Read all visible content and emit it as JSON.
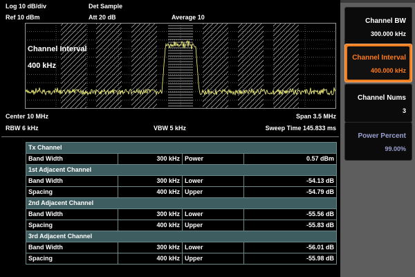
{
  "header": {
    "scale": "Log 10 dB/div",
    "ref": "Ref 10 dBm",
    "det": "Det Sample",
    "att": "Att 20 dB",
    "average": "Average 10"
  },
  "overlay": {
    "line1": "Channel Interval",
    "line2": "400 kHz"
  },
  "footer": {
    "center": "Center 10 MHz",
    "span": "Span 3.5 MHz",
    "rbw": "RBW 6 kHz",
    "vbw": "VBW 5 kHz",
    "sweep": "Sweep Time 145.833 ms"
  },
  "colors": {
    "trace": "#ffff80",
    "grid": "#8a8a8a",
    "accent": "#f07d1e",
    "table_head": "#3e5d60"
  },
  "table": {
    "tx": {
      "title": "Tx Channel",
      "bw_label": "Band Width",
      "bw_value": "300 kHz",
      "power_label": "Power",
      "power_value": "0.57 dBm"
    },
    "adj": [
      {
        "title": "1st Adjacent Channel",
        "bw_label": "Band Width",
        "bw_value": "300 kHz",
        "lower_label": "Lower",
        "lower_value": "-54.13 dB",
        "sp_label": "Spacing",
        "sp_value": "400 kHz",
        "upper_label": "Upper",
        "upper_value": "-54.79 dB"
      },
      {
        "title": "2nd Adjacent Channel",
        "bw_label": "Band Width",
        "bw_value": "300 kHz",
        "lower_label": "Lower",
        "lower_value": "-55.56 dB",
        "sp_label": "Spacing",
        "sp_value": "400 kHz",
        "upper_label": "Upper",
        "upper_value": "-55.83 dB"
      },
      {
        "title": "3rd Adjacent Channel",
        "bw_label": "Band Width",
        "bw_value": "300 kHz",
        "lower_label": "Lower",
        "lower_value": "-56.01 dB",
        "sp_label": "Spacing",
        "sp_value": "400 kHz",
        "upper_label": "Upper",
        "upper_value": "-55.98 dB"
      }
    ]
  },
  "menu": [
    {
      "label": "Channel BW",
      "value": "300.000 kHz",
      "state": "normal"
    },
    {
      "label": "Channel Interval",
      "value": "400.000 kHz",
      "state": "active"
    },
    {
      "label": "Channel Nums",
      "value": "3",
      "state": "normal"
    },
    {
      "label": "Power Percent",
      "value": "99.00%",
      "state": "disabled"
    }
  ]
}
